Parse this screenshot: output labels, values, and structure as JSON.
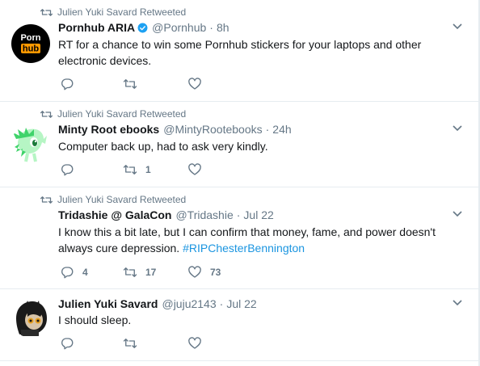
{
  "colors": {
    "text_primary": "#14171a",
    "text_secondary": "#657786",
    "hashtag": "#1b95e0",
    "verified_badge": "#1da1f2",
    "divider": "#e6ecf0"
  },
  "tweets": [
    {
      "retweet_label": "Julien Yuki Savard Retweeted",
      "display_name": "Pornhub ARIA",
      "verified": true,
      "handle": "@Pornhub",
      "dot": "·",
      "time": "8h",
      "text_line1": "RT for a chance to win some Pornhub stickers for your laptops and other",
      "text_line2": "electronic devices.",
      "avatar": {
        "icon": "pornhub-logo",
        "line1": "Porn",
        "line2": "hub"
      },
      "reply_count": "",
      "retweet_count": "",
      "like_count": ""
    },
    {
      "retweet_label": "Julien Yuki Savard Retweeted",
      "display_name": "Minty Root ebooks",
      "handle": "@MintyRootebooks",
      "dot": "·",
      "time": "24h",
      "text_line1": "Computer back up, had to ask very kindly.",
      "avatar": {
        "icon": "green-pony-avatar"
      },
      "reply_count": "",
      "retweet_count": "1",
      "like_count": ""
    },
    {
      "retweet_label": "Julien Yuki Savard Retweeted",
      "display_name": "Tridashie @ GalaCon",
      "handle": "@Tridashie",
      "dot": "·",
      "time": "Jul 22",
      "text_line1": "I know this a bit late, but I can confirm that money, fame, and power doesn't",
      "text_line2": "always cure depression.",
      "hashtag": "#RIPChesterBennington",
      "avatar": {
        "icon": "none"
      },
      "reply_count": "4",
      "retweet_count": "17",
      "like_count": "73"
    },
    {
      "display_name": "Julien Yuki Savard",
      "handle": "@juju2143",
      "dot": "·",
      "time": "Jul 22",
      "text_line1": "I should sleep.",
      "avatar": {
        "icon": "dark-character-avatar"
      },
      "reply_count": "",
      "retweet_count": "",
      "like_count": ""
    }
  ]
}
